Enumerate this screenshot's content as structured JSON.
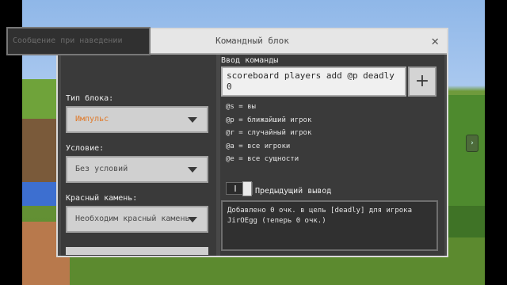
{
  "dialog": {
    "title": "Командный блок",
    "close_glyph": "✕"
  },
  "left": {
    "hover_placeholder": "Сообщение при наведении",
    "block_type_label": "Тип блока:",
    "block_type_value": "Импульс",
    "condition_label": "Условие:",
    "condition_value": "Без условий",
    "redstone_label": "Красный камень:",
    "redstone_value": "Необходим красный камень"
  },
  "right": {
    "command_label": "Ввод команды",
    "command_text": "scoreboard players add @p deadly 0",
    "plus_glyph": "+",
    "selectors": [
      "@s = вы",
      "@p = ближайший игрок",
      "@r = случайный игрок",
      "@a = все игроки",
      "@e = все сущности"
    ],
    "previous_output_label": "Предыдущий вывод",
    "previous_output_on": true,
    "output_text": "Добавлено 0 очк. в цель [deadly] для игрока JirOEgg (теперь 0 очк.)"
  },
  "colors": {
    "orange_value": "#e07a2a",
    "dialog_bg": "#484848",
    "titlebar_bg": "#e6e6e6"
  },
  "icons": [
    "close-icon",
    "chevron-down-icon",
    "plus-icon"
  ]
}
